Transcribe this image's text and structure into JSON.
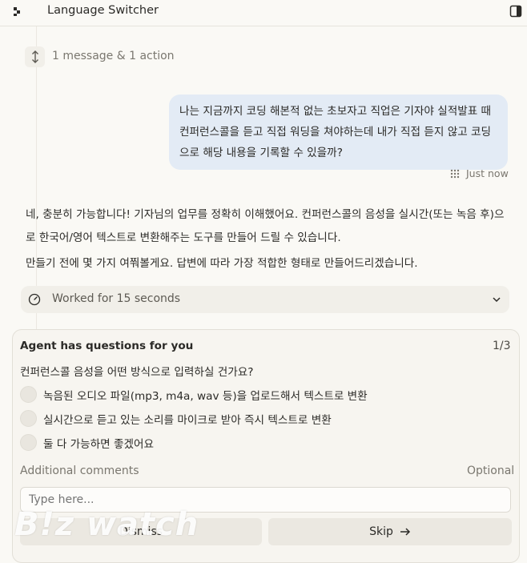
{
  "app": {
    "title": "Language Switcher"
  },
  "collapsed_group": {
    "label": "1 message & 1 action"
  },
  "user_message": {
    "text": "나는 지금까지 코딩 해본적 없는 초보자고 직업은 기자야 실적발표 때 컨퍼런스콜을 듣고 직접 워딩을 쳐야하는데 내가 직접 듣지 않고 코딩으로 해당 내용을 기록할 수 있을까?",
    "timestamp": "Just now"
  },
  "assistant": {
    "paragraph1": "네, 충분히 가능합니다! 기자님의 업무를 정확히 이해했어요. 컨퍼런스콜의 음성을 실시간(또는 녹음 후)으로 한국어/영어 텍스트로 변환해주는 도구를 만들어 드릴 수 있습니다.",
    "paragraph2": "만들기 전에 몇 가지 여쭤볼게요. 답변에 따라 가장 적합한 형태로 만들어드리겠습니다."
  },
  "worked": {
    "label": "Worked for 15 seconds"
  },
  "questions": {
    "title": "Agent has questions for you",
    "counter": "1/3",
    "question": "컨퍼런스콜 음성을 어떤 방식으로 입력하실 건가요?",
    "options": [
      {
        "label": "녹음된 오디오 파일(mp3, m4a, wav 등)을 업로드해서 텍스트로 변환"
      },
      {
        "label": "실시간으로 듣고 있는 소리를 마이크로 받아 즉시 텍스트로 변환"
      },
      {
        "label": "둘 다 가능하면 좋겠어요"
      }
    ],
    "comments_label": "Additional comments",
    "comments_optional": "Optional",
    "comments_placeholder": "Type here...",
    "dismiss_label": "Dismiss",
    "skip_label": "Skip"
  },
  "watermark": {
    "text": "B!z watch"
  },
  "colors": {
    "bubble": "#e3ebf5",
    "background": "#faf9f5",
    "card": "#f7f5f0"
  }
}
